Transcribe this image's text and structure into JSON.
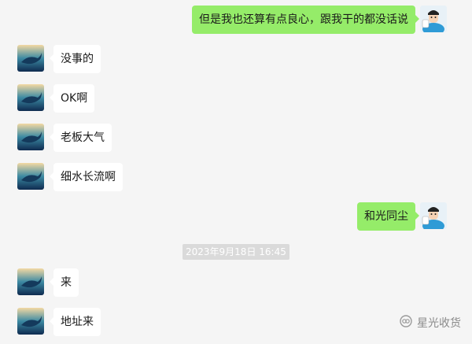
{
  "chat": {
    "messages": [
      {
        "side": "right",
        "text": "但是我也还算有点良心，跟我干的都没话说"
      },
      {
        "side": "left",
        "text": "没事的"
      },
      {
        "side": "left",
        "text": "OK啊"
      },
      {
        "side": "left",
        "text": "老板大气"
      },
      {
        "side": "left",
        "text": "细水长流啊"
      },
      {
        "side": "right",
        "text": "和光同尘"
      },
      {
        "side": "left",
        "text": "来"
      },
      {
        "side": "left",
        "text": "地址来"
      }
    ],
    "timestamp": "2023年9月18日 16:45"
  },
  "watermark": {
    "text": "星光收货",
    "icon": "wechat-official-account-icon"
  },
  "colors": {
    "background": "#f5f5f5",
    "incoming_bubble": "#ffffff",
    "outgoing_bubble": "#95ec69",
    "timestamp_bg": "#dadada"
  },
  "icons": {
    "contact_avatar": "whale-avatar-icon",
    "self_avatar": "cartoon-man-avatar-icon"
  }
}
